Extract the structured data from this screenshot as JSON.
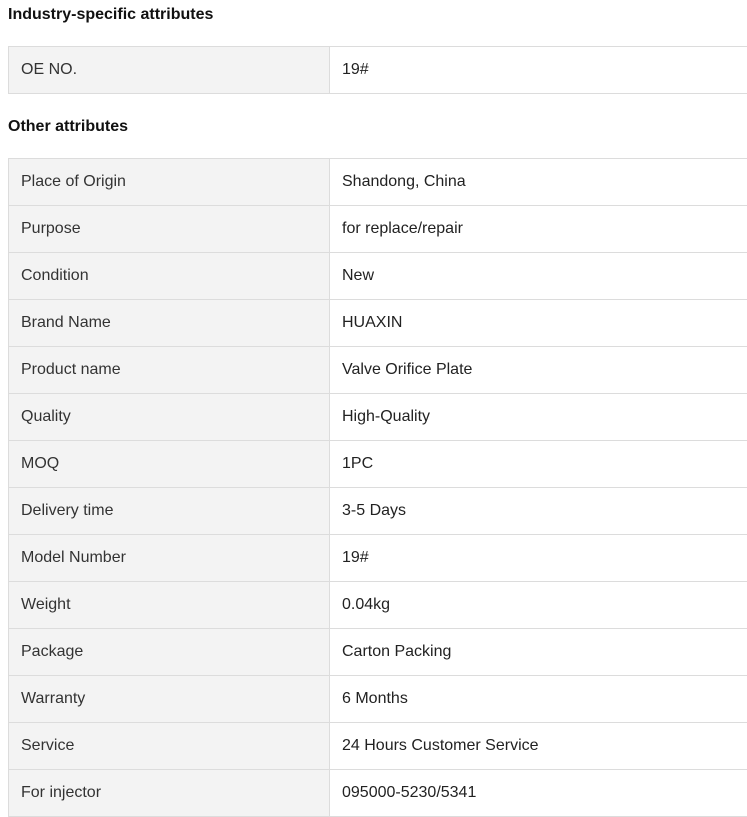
{
  "industry_section": {
    "title": "Industry-specific attributes",
    "rows": [
      {
        "label": "OE NO.",
        "value": "19#"
      }
    ]
  },
  "other_section": {
    "title": "Other attributes",
    "rows": [
      {
        "label": "Place of Origin",
        "value": "Shandong, China"
      },
      {
        "label": "Purpose",
        "value": "for replace/repair"
      },
      {
        "label": "Condition",
        "value": "New"
      },
      {
        "label": "Brand Name",
        "value": "HUAXIN"
      },
      {
        "label": "Product name",
        "value": "Valve Orifice Plate"
      },
      {
        "label": "Quality",
        "value": "High-Quality"
      },
      {
        "label": "MOQ",
        "value": "1PC"
      },
      {
        "label": "Delivery time",
        "value": "3-5 Days"
      },
      {
        "label": "Model Number",
        "value": "19#"
      },
      {
        "label": "Weight",
        "value": "0.04kg"
      },
      {
        "label": "Package",
        "value": "Carton Packing"
      },
      {
        "label": "Warranty",
        "value": "6 Months"
      },
      {
        "label": "Service",
        "value": "24 Hours Customer Service"
      },
      {
        "label": "For injector",
        "value": "095000-5230/5341"
      }
    ]
  }
}
